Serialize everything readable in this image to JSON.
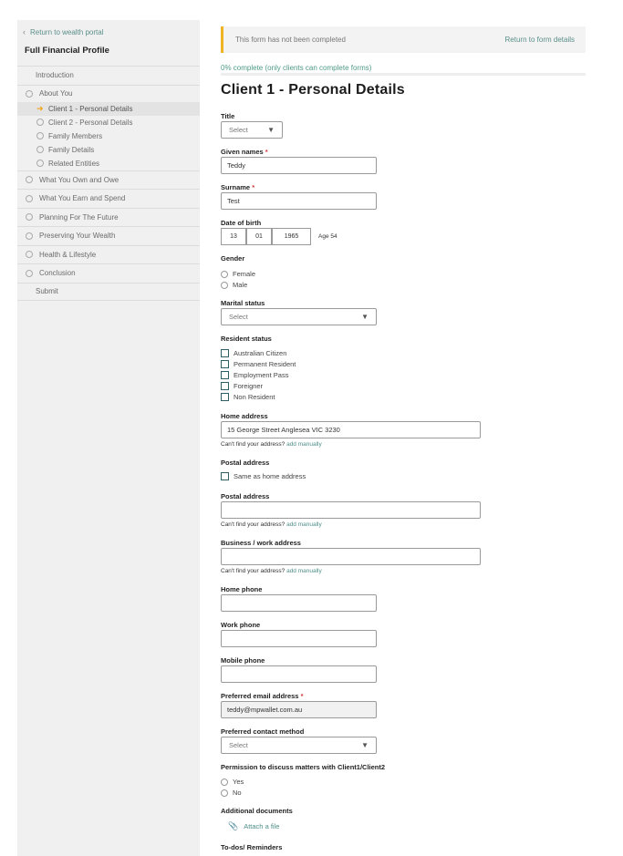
{
  "sidebar": {
    "back_label": "Return to wealth portal",
    "title": "Full Financial Profile",
    "items": [
      {
        "label": "Introduction"
      },
      {
        "label": "About You"
      },
      {
        "label": "Client 1 - Personal Details"
      },
      {
        "label": "Client 2 - Personal Details"
      },
      {
        "label": "Family Members"
      },
      {
        "label": "Family Details"
      },
      {
        "label": "Related Entities"
      },
      {
        "label": "What You Own and Owe"
      },
      {
        "label": "What You Earn and Spend"
      },
      {
        "label": "Planning For The Future"
      },
      {
        "label": "Preserving Your Wealth"
      },
      {
        "label": "Health & Lifestyle"
      },
      {
        "label": "Conclusion"
      },
      {
        "label": "Submit"
      }
    ]
  },
  "banner": {
    "message": "This form has not been completed",
    "link": "Return to form details"
  },
  "progress": {
    "text": "0% complete (only clients can complete forms)",
    "percent": 0
  },
  "form": {
    "title": "Client 1 - Personal Details",
    "title_label": "Title",
    "title_value": "Select",
    "given_label": "Given names",
    "given_value": "Teddy",
    "surname_label": "Surname",
    "surname_value": "Test",
    "dob_label": "Date of birth",
    "dob_day": "13",
    "dob_month": "01",
    "dob_year": "1965",
    "age": "Age 54",
    "gender_label": "Gender",
    "gender_options": [
      "Female",
      "Male"
    ],
    "marital_label": "Marital status",
    "marital_value": "Select",
    "resident_label": "Resident status",
    "resident_options": [
      "Australian Citizen",
      "Permanent Resident",
      "Employment Pass",
      "Foreigner",
      "Non Resident"
    ],
    "home_address_label": "Home address",
    "home_address_value": "15 George Street Anglesea VIC 3230",
    "cant_find": "Can't find your address?",
    "add_manually": "add manually",
    "postal_section_label": "Postal address",
    "same_as_home": "Same as home address",
    "postal_label": "Postal address",
    "business_label": "Business / work address",
    "home_phone_label": "Home phone",
    "work_phone_label": "Work phone",
    "mobile_phone_label": "Mobile phone",
    "email_label": "Preferred email address",
    "email_value": "teddy@mpwallet.com.au",
    "contact_label": "Preferred contact method",
    "contact_value": "Select",
    "permission_label": "Permission to discuss matters with Client1/Client2",
    "permission_options": [
      "Yes",
      "No"
    ],
    "additional_label": "Additional documents",
    "attach_label": "Attach a file",
    "todos_label": "To-dos/ Reminders",
    "required_mark": "*"
  },
  "icons": {
    "back": "chevron-left-icon",
    "current": "arrow-right-icon",
    "attach": "paperclip-icon",
    "dropdown": "triangle-down-icon"
  },
  "colors": {
    "accent": "#f0b323",
    "link": "#4f8f8a",
    "sidebar_bg": "#f0f0f0"
  }
}
